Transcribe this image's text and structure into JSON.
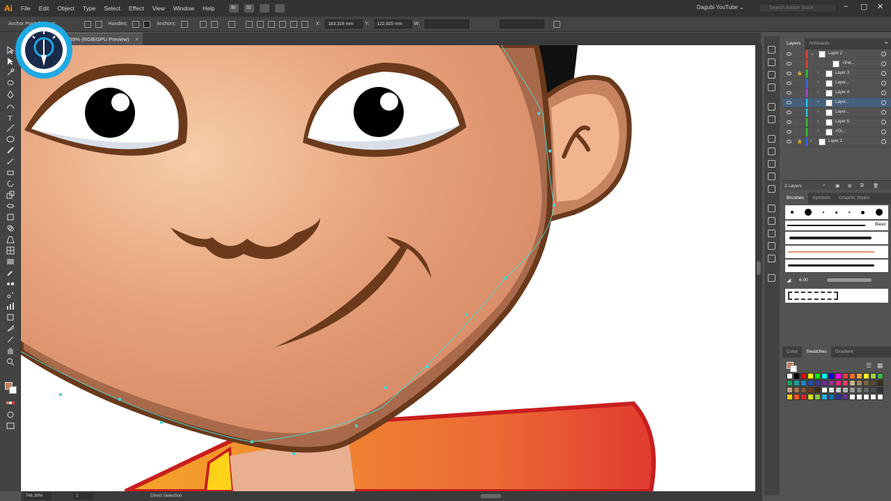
{
  "app": {
    "logo": "Ai"
  },
  "menu": [
    "File",
    "Edit",
    "Object",
    "Type",
    "Select",
    "Effect",
    "View",
    "Window",
    "Help"
  ],
  "menubar_icons": {
    "bridge": "Br",
    "stock": "St"
  },
  "workspace": "Dagubi YouTube",
  "search_placeholder": "Search Adobe Stock",
  "control": {
    "anchor_point_label": "Anchor Point",
    "convert_suffix": "Convert:",
    "handles_label": "Handles:",
    "anchors_label": "Anchors:",
    "x_label": "X:",
    "x_value": "183.316 mm",
    "y_label": "Y:",
    "y_value": "122.925 mm",
    "w_label": "W:"
  },
  "document": {
    "tab_title": "39% (RGB/GPU Preview)",
    "close": "×"
  },
  "status": {
    "zoom": "746.39%",
    "page": "1",
    "tool": "Direct Selection"
  },
  "layers_panel": {
    "tabs": [
      "Layers",
      "Artboards"
    ],
    "footer": "2 Layers",
    "rows": [
      {
        "name": "Layer 2",
        "color": "#e8473a",
        "indent": 0,
        "arrow": "⌄",
        "lock": false,
        "selected": false
      },
      {
        "name": "<Pat...",
        "color": "#e8473a",
        "indent": 2,
        "arrow": "",
        "lock": false,
        "selected": false
      },
      {
        "name": "Layer 3",
        "color": "#3ec63b",
        "indent": 1,
        "arrow": "›",
        "lock": true,
        "selected": false
      },
      {
        "name": "Layer...",
        "color": "#3b6cf2",
        "indent": 1,
        "arrow": "›",
        "lock": false,
        "selected": false
      },
      {
        "name": "Layer 4",
        "color": "#b04ce0",
        "indent": 1,
        "arrow": "›",
        "lock": false,
        "selected": false
      },
      {
        "name": "Layer...",
        "color": "#2fd0e0",
        "indent": 1,
        "arrow": "›",
        "lock": false,
        "selected": true
      },
      {
        "name": "Layer...",
        "color": "#2fd0e0",
        "indent": 1,
        "arrow": "›",
        "lock": false,
        "selected": false
      },
      {
        "name": "Layer 6",
        "color": "#3ec63b",
        "indent": 1,
        "arrow": "›",
        "lock": false,
        "selected": false
      },
      {
        "name": "<Gr...",
        "color": "#3ec63b",
        "indent": 1,
        "arrow": "›",
        "lock": false,
        "selected": false
      },
      {
        "name": "Layer 1",
        "color": "#3b6cf2",
        "indent": 0,
        "arrow": "›",
        "lock": true,
        "selected": false
      }
    ]
  },
  "brushes_panel": {
    "tabs": [
      "Brushes",
      "Symbols",
      "Graphic Styles"
    ],
    "basic_label": "Basic",
    "size_label": "6.00"
  },
  "swatches_panel": {
    "tabs": [
      "Color",
      "Swatches",
      "Gradient"
    ],
    "colors": [
      "#ffffff",
      "#000000",
      "#ff0000",
      "#ffff00",
      "#00ff00",
      "#00ffff",
      "#0000ff",
      "#ff00ff",
      "#e83a3a",
      "#f26b36",
      "#f7a733",
      "#fff22e",
      "#9ccf3c",
      "#3fb54a",
      "#1e9f5a",
      "#1c9fa0",
      "#1b89c9",
      "#2b4ea3",
      "#3a3a96",
      "#6b2f91",
      "#9b2b8f",
      "#e1297a",
      "#ea3a5a",
      "#c5b38c",
      "#9a8660",
      "#7a6545",
      "#5c4a30",
      "#3b2e1d",
      "#c8a081",
      "#a6734d",
      "#8a5530",
      "#6b3d1b",
      "#4c2a12",
      "#ffffff",
      "#e6e6e6",
      "#cccccc",
      "#b3b3b3",
      "#999999",
      "#808080",
      "#666666",
      "#4d4d4d",
      "#333333",
      "#ffcc00",
      "#f15a24",
      "#ed1c24",
      "#d9e021",
      "#8cc63f",
      "#29abe2",
      "#0071bc",
      "#2e3192",
      "#662d91",
      "#ffffff",
      "#ffffff",
      "#ffffff",
      "#ffffff",
      "#ffffff"
    ]
  }
}
